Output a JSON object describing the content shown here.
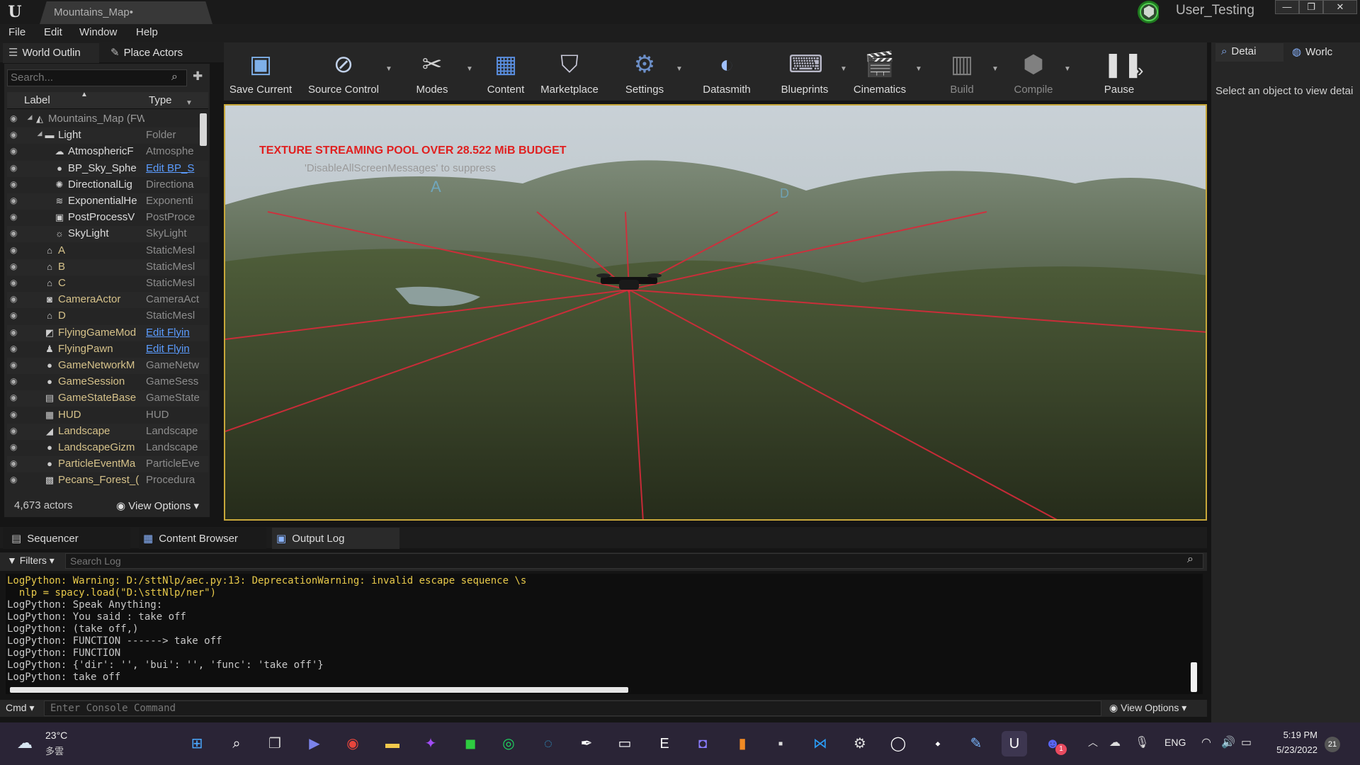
{
  "window": {
    "tab_title": "Mountains_Map•",
    "user_name": "User_Testing",
    "controls": [
      "—",
      "❐",
      "✕"
    ]
  },
  "menu": [
    "File",
    "Edit",
    "Window",
    "Help"
  ],
  "left_panel": {
    "tabs": [
      "World Outlin",
      "Place Actors"
    ],
    "search_placeholder": "Search...",
    "columns": {
      "label": "Label",
      "type": "Type"
    },
    "rows": [
      {
        "label": "Mountains_Map (FWorld",
        "type": "",
        "indent": 0,
        "icon": "world-icon"
      },
      {
        "label": "Light",
        "type": "Folder",
        "indent": 1,
        "icon": "folder-icon"
      },
      {
        "label": "AtmosphericF",
        "type": "Atmosphe",
        "indent": 2,
        "icon": "atmosphere-icon"
      },
      {
        "label": "BP_Sky_Sphe",
        "type": "Edit BP_S",
        "indent": 2,
        "icon": "sphere-icon",
        "link": true
      },
      {
        "label": "DirectionalLig",
        "type": "Directiona",
        "indent": 2,
        "icon": "directional-light-icon"
      },
      {
        "label": "ExponentialHe",
        "type": "Exponenti",
        "indent": 2,
        "icon": "fog-icon"
      },
      {
        "label": "PostProcessV",
        "type": "PostProce",
        "indent": 2,
        "icon": "postprocess-icon"
      },
      {
        "label": "SkyLight",
        "type": "SkyLight",
        "indent": 2,
        "icon": "skylight-icon"
      },
      {
        "label": "A",
        "type": "StaticMesl",
        "indent": 1,
        "icon": "static-mesh-icon"
      },
      {
        "label": "B",
        "type": "StaticMesl",
        "indent": 1,
        "icon": "static-mesh-icon"
      },
      {
        "label": "C",
        "type": "StaticMesl",
        "indent": 1,
        "icon": "static-mesh-icon"
      },
      {
        "label": "CameraActor",
        "type": "CameraAct",
        "indent": 1,
        "icon": "camera-icon"
      },
      {
        "label": "D",
        "type": "StaticMesl",
        "indent": 1,
        "icon": "static-mesh-icon"
      },
      {
        "label": "FlyingGameMod",
        "type": "Edit Flyin",
        "indent": 1,
        "icon": "gamemode-icon",
        "link": true
      },
      {
        "label": "FlyingPawn",
        "type": "Edit Flyin",
        "indent": 1,
        "icon": "pawn-icon",
        "link": true
      },
      {
        "label": "GameNetworkM",
        "type": "GameNetw",
        "indent": 1,
        "icon": "sphere-icon"
      },
      {
        "label": "GameSession",
        "type": "GameSess",
        "indent": 1,
        "icon": "sphere-icon"
      },
      {
        "label": "GameStateBase",
        "type": "GameState",
        "indent": 1,
        "icon": "gamestate-icon"
      },
      {
        "label": "HUD",
        "type": "HUD",
        "indent": 1,
        "icon": "hud-icon"
      },
      {
        "label": "Landscape",
        "type": "Landscape",
        "indent": 1,
        "icon": "landscape-icon"
      },
      {
        "label": "LandscapeGizm",
        "type": "Landscape",
        "indent": 1,
        "icon": "sphere-icon"
      },
      {
        "label": "ParticleEventMa",
        "type": "ParticleEve",
        "indent": 1,
        "icon": "sphere-icon"
      },
      {
        "label": "Pecans_Forest_(",
        "type": "Procedura",
        "indent": 1,
        "icon": "procedural-icon"
      }
    ],
    "actor_count": "4,673 actors",
    "view_options": "View Options"
  },
  "toolbar": [
    {
      "label": "Save Current",
      "icon": "save-icon",
      "color": "#7fb0e8"
    },
    {
      "label": "Source Control",
      "icon": "source-control-icon",
      "color": "#c0d0e8"
    },
    {
      "label": "Modes",
      "icon": "modes-icon",
      "color": "#d0d0d0"
    },
    {
      "label": "Content",
      "icon": "content-icon",
      "color": "#5a8fe0"
    },
    {
      "label": "Marketplace",
      "icon": "marketplace-icon",
      "color": "#c8c8d8"
    },
    {
      "label": "Settings",
      "icon": "settings-icon",
      "color": "#6c8fc8"
    },
    {
      "label": "Datasmith",
      "icon": "datasmith-icon",
      "color": "#9fc0ff"
    },
    {
      "label": "Blueprints",
      "icon": "blueprints-icon",
      "color": "#b8b8c8"
    },
    {
      "label": "Cinematics",
      "icon": "cinematics-icon",
      "color": "#c0c0c0"
    },
    {
      "label": "Build",
      "icon": "build-icon",
      "color": "#808080",
      "dim": true
    },
    {
      "label": "Compile",
      "icon": "compile-icon",
      "color": "#808080",
      "dim": true
    },
    {
      "label": "Pause",
      "icon": "pause-icon",
      "color": "#e0e0e0"
    }
  ],
  "viewport": {
    "warning": "TEXTURE STREAMING POOL OVER 28.522 MiB BUDGET",
    "suppress_hint": "'DisableAllScreenMessages' to suppress",
    "marker_a": "A",
    "marker_d": "D"
  },
  "right_panel": {
    "tabs": [
      "Detai",
      "Worlc"
    ],
    "message": "Select an object to view detai"
  },
  "bottom_tabs": [
    "Sequencer",
    "Content Browser",
    "Output Log"
  ],
  "output_log": {
    "filters": "Filters",
    "search_placeholder": "Search Log",
    "lines": [
      {
        "text": "LogPython: Warning: D:/sttNlp/aec.py:13: DeprecationWarning: invalid escape sequence \\s",
        "warn": true
      },
      {
        "text": "  nlp = spacy.load(\"D:\\sttNlp/ner\")",
        "warn": true
      },
      {
        "text": "LogPython: Speak Anything:",
        "warn": false
      },
      {
        "text": "LogPython: You said : take off",
        "warn": false
      },
      {
        "text": "LogPython: (take off,)",
        "warn": false
      },
      {
        "text": "LogPython: FUNCTION ------> take off",
        "warn": false
      },
      {
        "text": "LogPython: FUNCTION",
        "warn": false
      },
      {
        "text": "LogPython: {'dir': '', 'bui': '', 'func': 'take off'}",
        "warn": false
      },
      {
        "text": "LogPython: take off",
        "warn": false
      }
    ],
    "cmd_label": "Cmd",
    "console_placeholder": "Enter Console Command",
    "view_options": "View Options"
  },
  "taskbar": {
    "weather_temp": "23°C",
    "weather_desc": "多雲",
    "apps": [
      {
        "icon": "windows-start-icon",
        "color": "#4aa8ff"
      },
      {
        "icon": "search-icon",
        "color": "#ffffff"
      },
      {
        "icon": "task-view-icon",
        "color": "#d0d0d0"
      },
      {
        "icon": "teams-chat-icon",
        "color": "#7b83eb"
      },
      {
        "icon": "chrome-icon",
        "color": "#e8453c"
      },
      {
        "icon": "file-explorer-icon",
        "color": "#f2c94c"
      },
      {
        "icon": "messenger-icon",
        "color": "#a14cf5"
      },
      {
        "icon": "line-icon",
        "color": "#2ecc40"
      },
      {
        "icon": "spotify-icon",
        "color": "#1ed760"
      },
      {
        "icon": "edge-icon",
        "color": "#2fa8e0"
      },
      {
        "icon": "inkscape-icon",
        "color": "#ffffff"
      },
      {
        "icon": "oculus-icon",
        "color": "#ffffff"
      },
      {
        "icon": "epic-games-icon",
        "color": "#ffffff"
      },
      {
        "icon": "game-pass-icon",
        "color": "#8a7cff"
      },
      {
        "icon": "sublime-icon",
        "color": "#f08a24"
      },
      {
        "icon": "terminal-icon",
        "color": "#dddddd"
      },
      {
        "icon": "vscode-icon",
        "color": "#2b9af3"
      },
      {
        "icon": "steam-icon",
        "color": "#dddddd"
      },
      {
        "icon": "github-icon",
        "color": "#ffffff"
      },
      {
        "icon": "dice-icon",
        "color": "#ffffff"
      },
      {
        "icon": "notepad-icon",
        "color": "#7ab8ff"
      },
      {
        "icon": "unreal-icon",
        "color": "#ffffff"
      },
      {
        "icon": "discord-icon",
        "color": "#5865f2"
      }
    ],
    "discord_badge": "1",
    "language": "ENG",
    "time": "5:19 PM",
    "date": "5/23/2022",
    "notification_count": "21"
  }
}
